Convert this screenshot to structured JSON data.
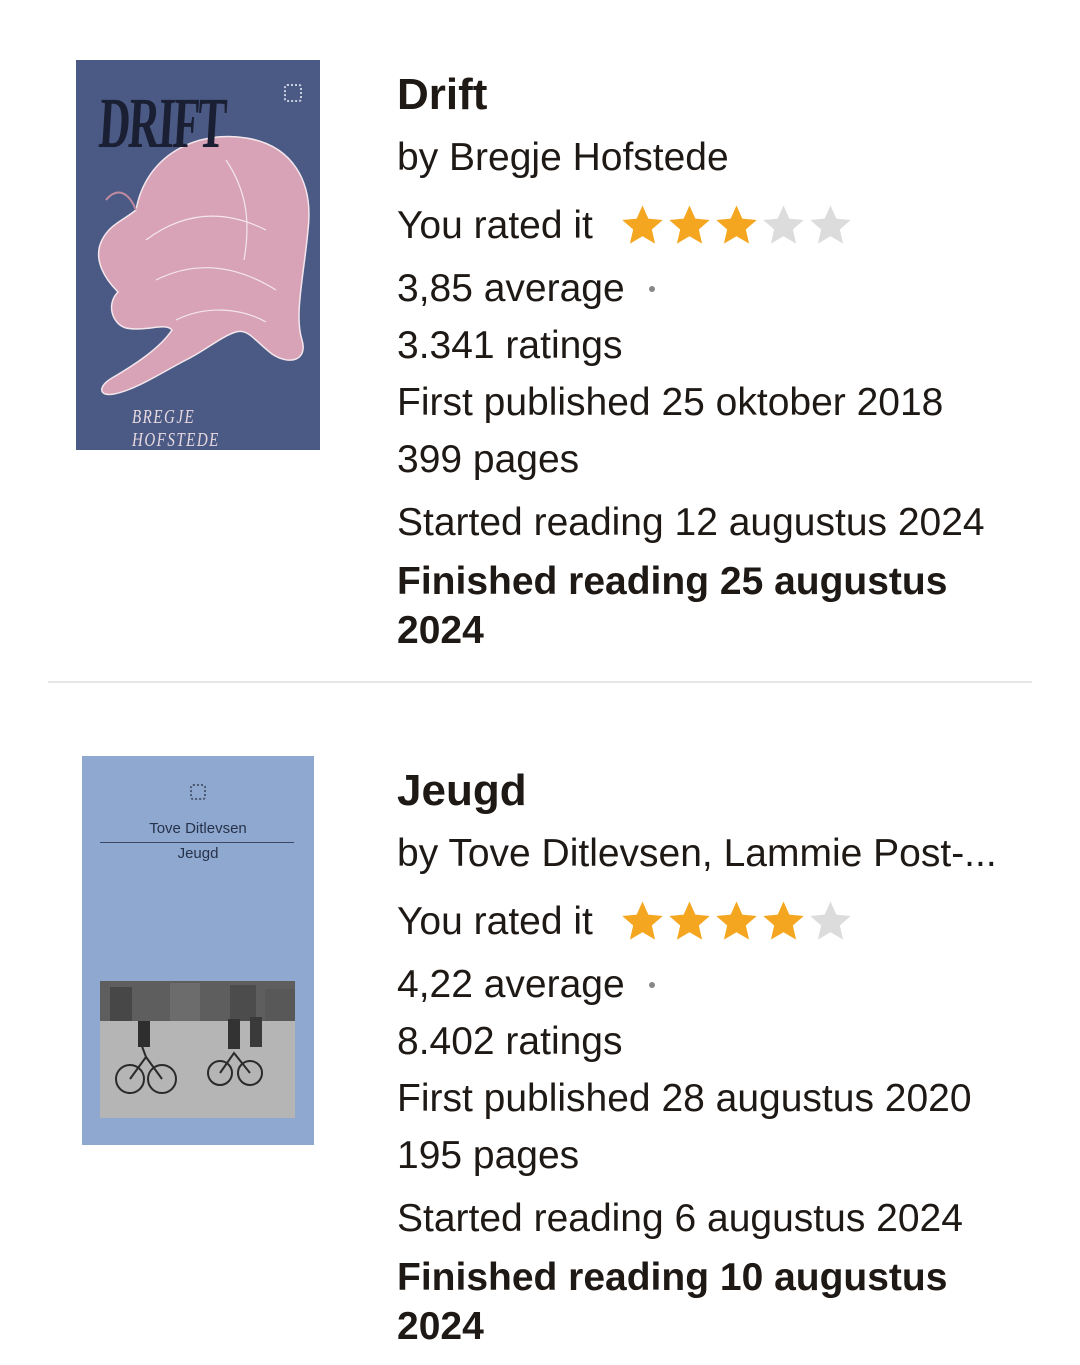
{
  "books": [
    {
      "title": "Drift",
      "author": "by Bregje Hofstede",
      "rated_label": "You rated it",
      "user_rating": 3,
      "max_rating": 5,
      "average": "3,85 average",
      "ratings": "3.341 ratings",
      "first_published": "First published 25 oktober 2018",
      "pages": "399 pages",
      "started": "Started reading 12 augustus 2024",
      "finished": "Finished reading 25 augustus\n2024",
      "cover": {
        "title_text": "DRIFT",
        "author_text": "BREGJE HOFSTEDE",
        "background": "#4a5a85"
      }
    },
    {
      "title": "Jeugd",
      "author": "by Tove Ditlevsen, Lammie Post-...",
      "rated_label": "You rated it",
      "user_rating": 4,
      "max_rating": 5,
      "average": "4,22 average",
      "ratings": "8.402 ratings",
      "first_published": "First published 28 augustus 2020",
      "pages": "195 pages",
      "started": "Started reading 6 augustus 2024",
      "finished": "Finished reading 10 augustus\n2024",
      "cover": {
        "title_text": "Jeugd",
        "author_text": "Tove Ditlevsen",
        "background": "#8fa8cf"
      }
    }
  ],
  "colors": {
    "star_filled": "#f4a621",
    "star_empty": "#dcdcdc",
    "text": "#1e1915",
    "divider": "#e6e6e6"
  },
  "icons": {
    "star": "star-icon",
    "publisher_logo": "publisher-logo-icon"
  }
}
